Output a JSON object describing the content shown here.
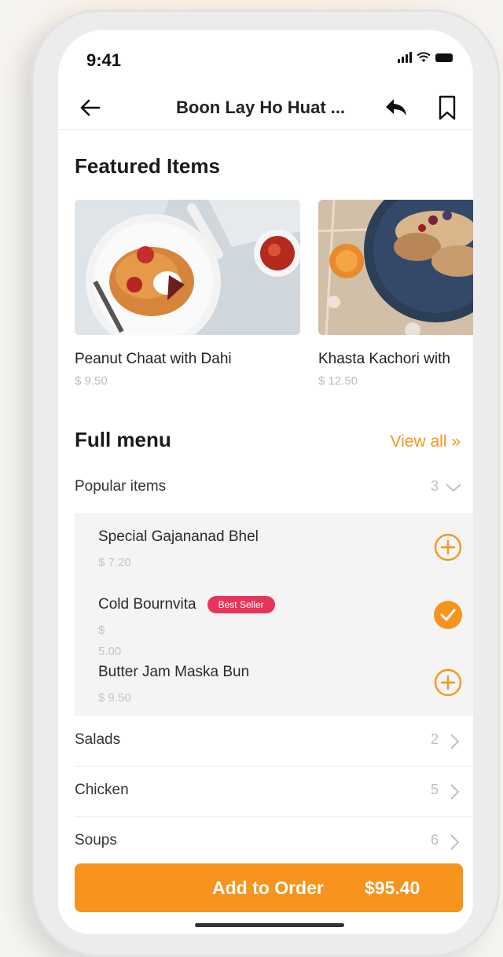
{
  "status": {
    "time": "9:41"
  },
  "nav": {
    "title": "Boon Lay Ho Huat ..."
  },
  "featured": {
    "title": "Featured Items",
    "items": [
      {
        "name": "Peanut Chaat with Dahi",
        "price": "$ 9.50"
      },
      {
        "name": "Khasta Kachori with",
        "price": "$ 12.50"
      }
    ]
  },
  "menu": {
    "title": "Full menu",
    "view_all": "View all »",
    "categories": [
      {
        "name": "Popular items",
        "count": "3",
        "expanded": true
      },
      {
        "name": "Salads",
        "count": "2"
      },
      {
        "name": "Chicken",
        "count": "5"
      },
      {
        "name": "Soups",
        "count": "6"
      }
    ],
    "popular_items": [
      {
        "name": "Special Gajananad Bhel",
        "price": "$ 7.20",
        "added": false
      },
      {
        "name": "Cold Bournvita",
        "badge": "Best Seller",
        "price_symbol": "$",
        "price_value": "5.00",
        "added": true
      },
      {
        "name": "Butter Jam Maska Bun",
        "price": "$ 9.50",
        "added": false
      }
    ]
  },
  "order": {
    "label": "Add to Order",
    "total": "$95.40"
  },
  "colors": {
    "accent": "#f7941d",
    "badge": "#e8345a"
  }
}
